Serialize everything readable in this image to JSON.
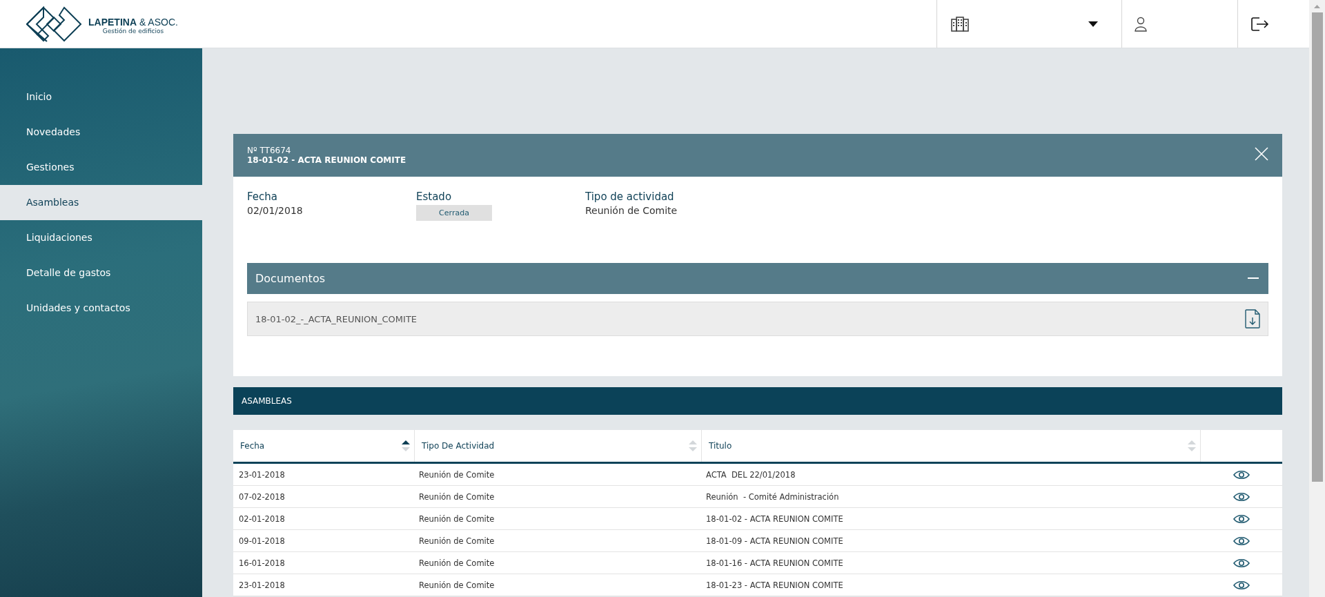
{
  "header": {
    "logo_name": "**LAPETINA** & ASOC.",
    "logo_tagline": "Gestión de edificios"
  },
  "sidebar": {
    "items": [
      {
        "label": "Inicio",
        "selected": false
      },
      {
        "label": "Novedades",
        "selected": false
      },
      {
        "label": "Gestiones",
        "selected": false
      },
      {
        "label": "Asambleas",
        "selected": true
      },
      {
        "label": "Liquidaciones",
        "selected": false
      },
      {
        "label": "Detalle de gastos",
        "selected": false
      },
      {
        "label": "Unidades y contactos",
        "selected": false
      }
    ]
  },
  "detail": {
    "number": "Nº TT6674",
    "title": "18-01-02 - ACTA REUNION COMITE",
    "fields": [
      {
        "label": "Fecha",
        "value": "02/01/2018",
        "kind": "text"
      },
      {
        "label": "Estado",
        "value": "Cerrada",
        "kind": "badge"
      },
      {
        "label": "Tipo de actividad",
        "value": "Reunión de Comite",
        "kind": "text"
      }
    ],
    "documents": {
      "title": "Documentos",
      "expanded": true,
      "files": [
        "18-01-02_-_ACTA_REUNION_COMITE"
      ]
    }
  },
  "table": {
    "title": "ASAMBLEAS",
    "columns": [
      {
        "label": "Fecha",
        "sorted": true
      },
      {
        "label": "Tipo De Actividad",
        "sorted": false
      },
      {
        "label": "Titulo",
        "sorted": false
      }
    ],
    "rows": [
      [
        "23-01-2018",
        "Reunión de Comite",
        "ACTA  DEL 22/01/2018"
      ],
      [
        "07-02-2018",
        "Reunión de Comite",
        "Reunión  - Comité Administración"
      ],
      [
        "02-01-2018",
        "Reunión de Comite",
        "18-01-02 - ACTA REUNION COMITE"
      ],
      [
        "09-01-2018",
        "Reunión de Comite",
        "18-01-09 - ACTA REUNION COMITE"
      ],
      [
        "16-01-2018",
        "Reunión de Comite",
        "18-01-16 - ACTA REUNION COMITE"
      ],
      [
        "23-01-2018",
        "Reunión de Comite",
        "18-01-23 - ACTA REUNION COMITE"
      ]
    ]
  }
}
